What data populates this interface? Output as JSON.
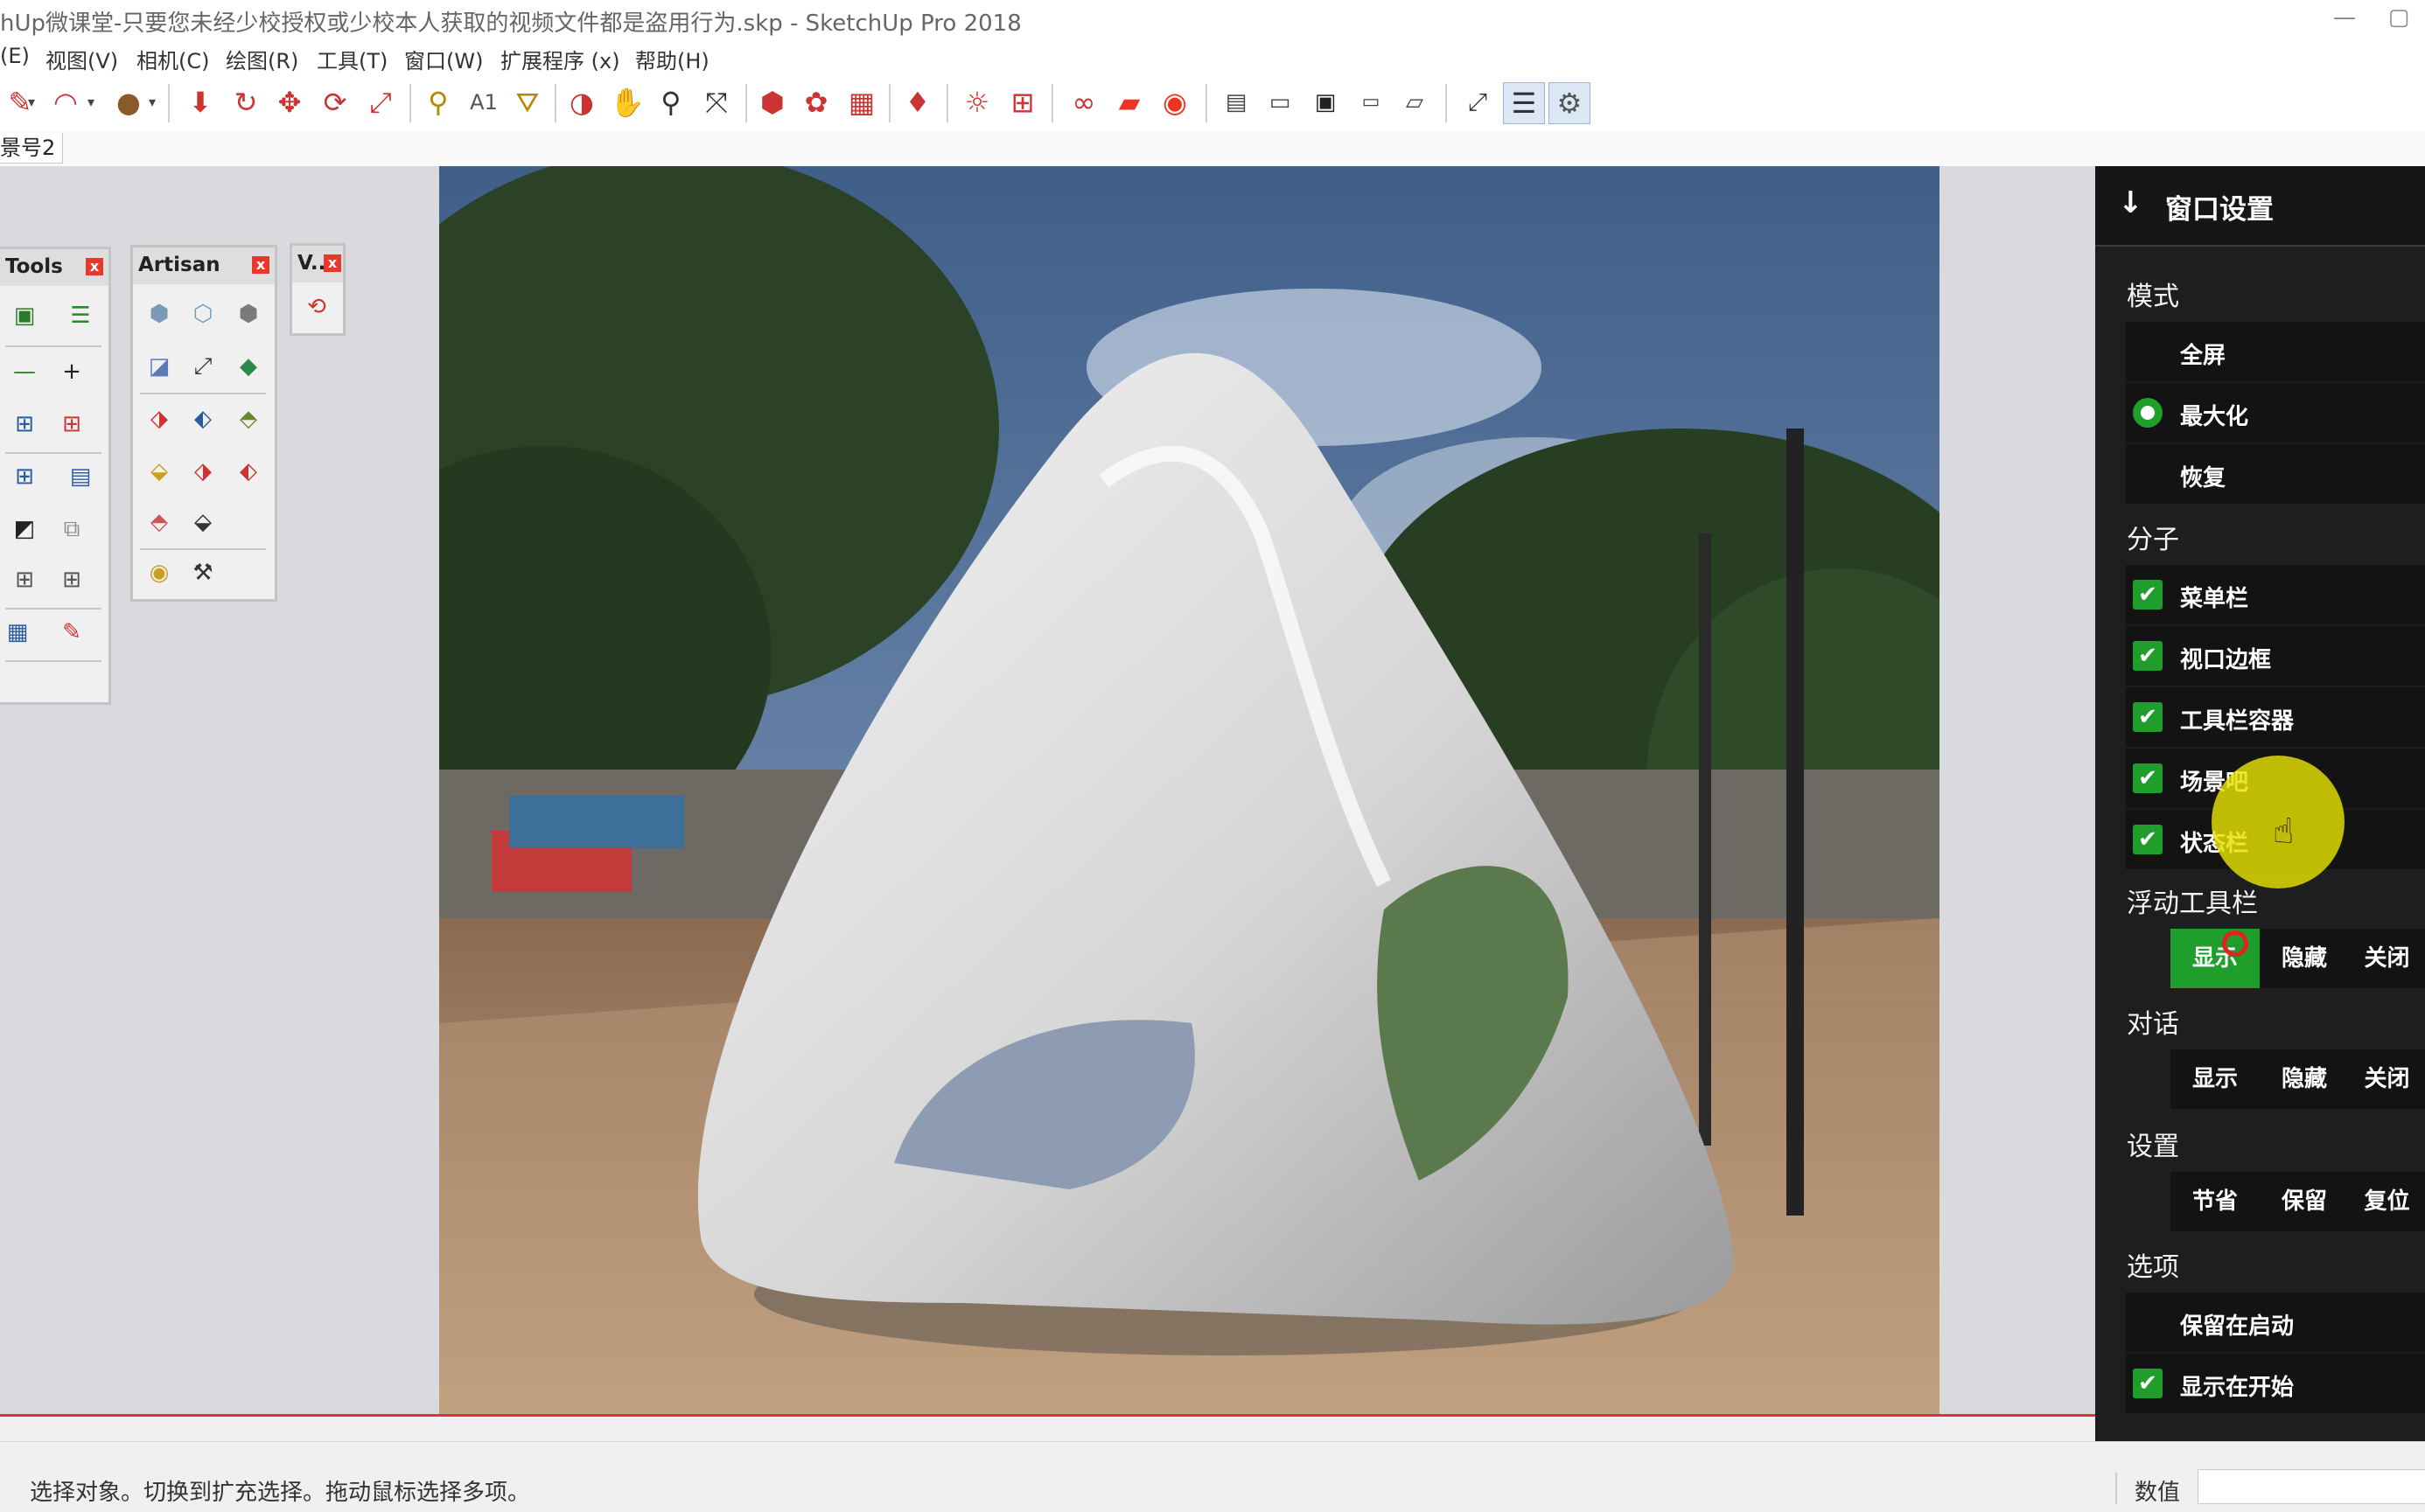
{
  "window": {
    "title": "hUp微课堂-只要您未经少校授权或少校本人获取的视频文件都是盗用行为.skp - SketchUp Pro 2018",
    "minimize_glyph": "—",
    "restore_glyph": "▢"
  },
  "menu": [
    "(E)",
    "视图(V)",
    "相机(C)",
    "绘图(R)",
    "工具(T)",
    "窗口(W)",
    "扩展程序 (x)",
    "帮助(H)"
  ],
  "toolbar_icons": [
    "pencil-icon",
    "dropdown-arrow-icon",
    "arc-icon",
    "dropdown-arrow-icon",
    "circle-icon",
    "dropdown-arrow-icon",
    "push-pull-icon",
    "follow-me-icon",
    "move-icon",
    "rotate-icon",
    "scale-icon",
    "tape-measure-icon",
    "text-icon",
    "paint-bucket-icon",
    "orbit-icon",
    "pan-icon",
    "zoom-icon",
    "zoom-extents-icon",
    "warehouse-icon",
    "components-icon",
    "extension-warehouse-icon",
    "ruby-icon",
    "sun-icon",
    "section-icon",
    "glasses-icon",
    "folder-red-icon",
    "camera-red-icon",
    "file-icon",
    "folder-icon",
    "save-icon",
    "rename-icon",
    "open-folder-icon",
    "fullscreen-icon",
    "panel-icon",
    "settings-icon"
  ],
  "scene": {
    "tab_label": "景号2"
  },
  "floating": {
    "tools": {
      "title": "Tools",
      "close": "x"
    },
    "artisan": {
      "title": "Artisan",
      "close": "x"
    },
    "v": {
      "title": "V..",
      "close": "x"
    }
  },
  "panel": {
    "header": "窗口设置",
    "header_icon": "↓",
    "sections": {
      "mode": {
        "title": "模式",
        "items": [
          {
            "label": "全屏",
            "selected": false
          },
          {
            "label": "最大化",
            "selected": true
          },
          {
            "label": "恢复",
            "selected": false
          }
        ]
      },
      "components": {
        "title": "分子",
        "items": [
          {
            "label": "菜单栏",
            "checked": true
          },
          {
            "label": "视口边框",
            "checked": true
          },
          {
            "label": "工具栏容器",
            "checked": true
          },
          {
            "label": "场景吧",
            "checked": true
          },
          {
            "label": "状态栏",
            "checked": true
          }
        ]
      },
      "floating_toolbars": {
        "title": "浮动工具栏",
        "buttons": [
          "显示",
          "隐藏",
          "关闭"
        ],
        "active": "显示"
      },
      "dialogs": {
        "title": "对话",
        "buttons": [
          "显示",
          "隐藏",
          "关闭"
        ]
      },
      "settings": {
        "title": "设置",
        "buttons": [
          "节省",
          "保留",
          "复位"
        ]
      },
      "options": {
        "title": "选项",
        "items": [
          {
            "label": "保留在启动",
            "checked": false
          },
          {
            "label": "显示在开始",
            "checked": true
          }
        ]
      }
    },
    "check_glyph": "✔"
  },
  "status": {
    "message": "选择对象。切换到扩充选择。拖动鼠标选择多项。",
    "value_label": "数值"
  },
  "colors": {
    "accent_green": "#1f9e2c",
    "panel_bg": "#1e1e1e",
    "cursor_highlight": "#e6e000"
  }
}
